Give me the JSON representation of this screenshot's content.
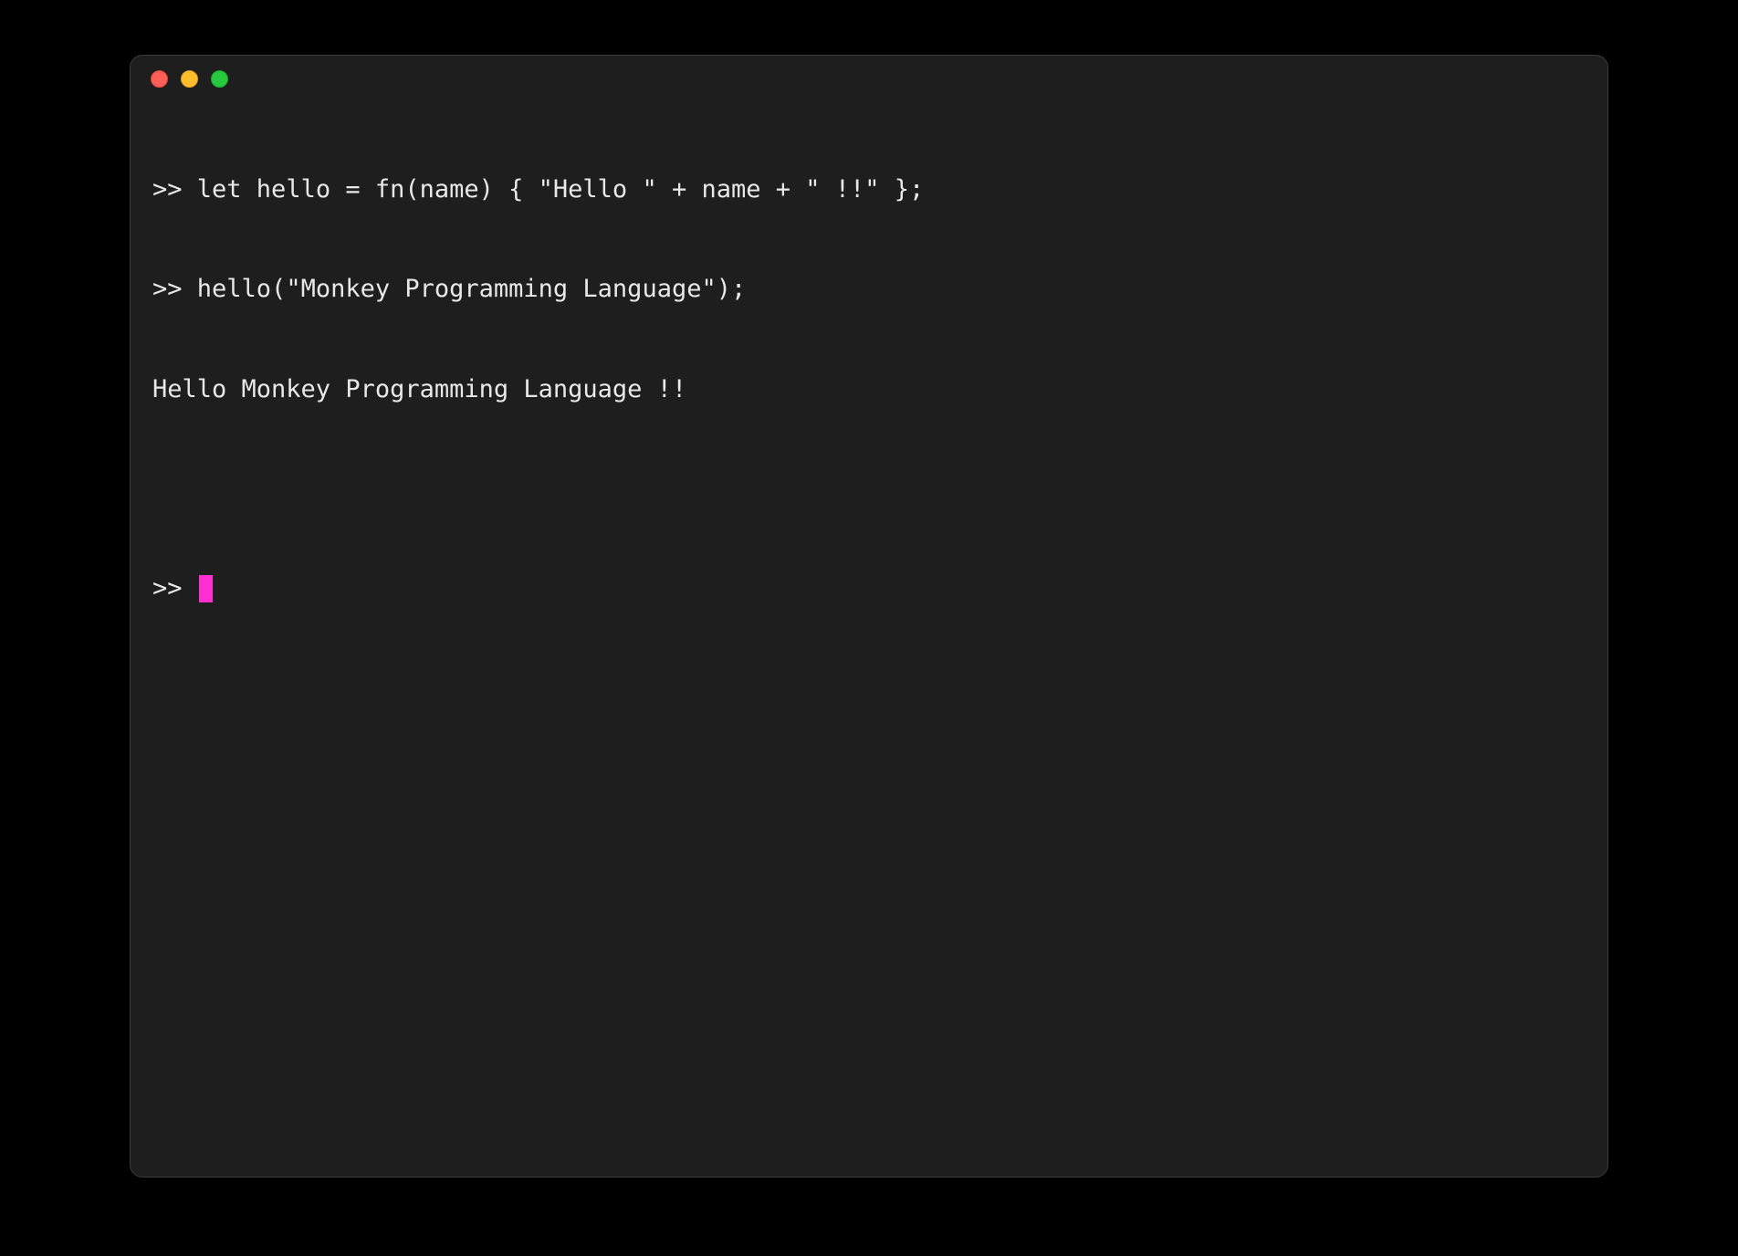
{
  "terminal": {
    "prompt": ">> ",
    "lines": [
      {
        "type": "input",
        "text": "let hello = fn(name) { \"Hello \" + name + \" !!\" };"
      },
      {
        "type": "input",
        "text": "hello(\"Monkey Programming Language\");"
      },
      {
        "type": "output",
        "text": "Hello Monkey Programming Language !!"
      }
    ],
    "cursor_color": "#ff2fd0"
  },
  "window": {
    "traffic_lights": {
      "close": "#ff5f56",
      "minimize": "#ffbd2e",
      "maximize": "#27c93f"
    }
  }
}
